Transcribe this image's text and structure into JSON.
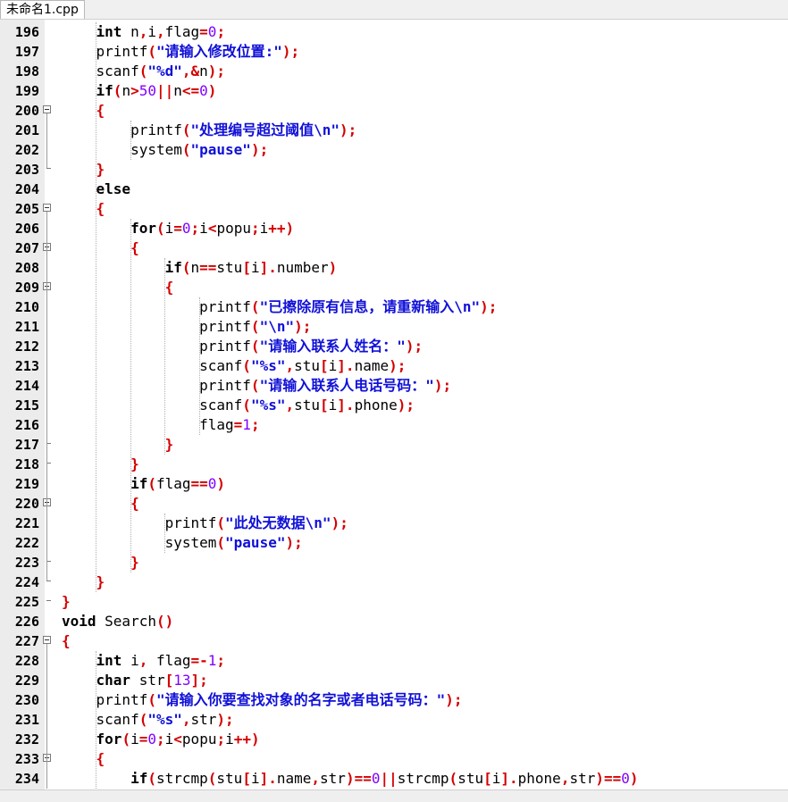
{
  "tab": {
    "title": "未命名1.cpp"
  },
  "status": {
    "items": [
      "",
      "",
      "",
      "",
      ""
    ]
  },
  "lines": [
    {
      "n": "196",
      "fold": "",
      "segs": [
        [
          "",
          "    "
        ],
        [
          "kw",
          "int"
        ],
        [
          "",
          " n"
        ],
        [
          "sym",
          ","
        ],
        [
          "",
          "i"
        ],
        [
          "sym",
          ","
        ],
        [
          "",
          "flag"
        ],
        [
          "sym",
          "="
        ],
        [
          "num",
          "0"
        ],
        [
          "sym",
          ";"
        ]
      ]
    },
    {
      "n": "197",
      "fold": "",
      "segs": [
        [
          "",
          "    printf"
        ],
        [
          "sym",
          "("
        ],
        [
          "str",
          "\"请输入修改位置:\""
        ],
        [
          "sym",
          ");"
        ]
      ]
    },
    {
      "n": "198",
      "fold": "",
      "segs": [
        [
          "",
          "    scanf"
        ],
        [
          "sym",
          "("
        ],
        [
          "str",
          "\"%d\""
        ],
        [
          "sym",
          ",&"
        ],
        [
          "",
          "n"
        ],
        [
          "sym",
          ");"
        ]
      ]
    },
    {
      "n": "199",
      "fold": "",
      "segs": [
        [
          "",
          "    "
        ],
        [
          "kw",
          "if"
        ],
        [
          "sym",
          "("
        ],
        [
          "",
          "n"
        ],
        [
          "sym",
          ">"
        ],
        [
          "num",
          "50"
        ],
        [
          "sym",
          "||"
        ],
        [
          "",
          "n"
        ],
        [
          "sym",
          "<="
        ],
        [
          "num",
          "0"
        ],
        [
          "sym",
          ")"
        ]
      ]
    },
    {
      "n": "200",
      "fold": "open",
      "segs": [
        [
          "",
          "    "
        ],
        [
          "sym",
          "{"
        ]
      ]
    },
    {
      "n": "201",
      "fold": "",
      "segs": [
        [
          "",
          "        printf"
        ],
        [
          "sym",
          "("
        ],
        [
          "str",
          "\"处理编号超过阈值\\n\""
        ],
        [
          "sym",
          ");"
        ]
      ]
    },
    {
      "n": "202",
      "fold": "",
      "segs": [
        [
          "",
          "        system"
        ],
        [
          "sym",
          "("
        ],
        [
          "str",
          "\"pause\""
        ],
        [
          "sym",
          ");"
        ]
      ]
    },
    {
      "n": "203",
      "fold": "end",
      "segs": [
        [
          "",
          "    "
        ],
        [
          "sym",
          "}"
        ]
      ]
    },
    {
      "n": "204",
      "fold": "",
      "segs": [
        [
          "",
          "    "
        ],
        [
          "kw",
          "else"
        ]
      ]
    },
    {
      "n": "205",
      "fold": "open",
      "segs": [
        [
          "",
          "    "
        ],
        [
          "sym",
          "{"
        ]
      ]
    },
    {
      "n": "206",
      "fold": "",
      "segs": [
        [
          "",
          "        "
        ],
        [
          "kw",
          "for"
        ],
        [
          "sym",
          "("
        ],
        [
          "",
          "i"
        ],
        [
          "sym",
          "="
        ],
        [
          "num",
          "0"
        ],
        [
          "sym",
          ";"
        ],
        [
          "",
          "i"
        ],
        [
          "sym",
          "<"
        ],
        [
          "",
          "popu"
        ],
        [
          "sym",
          ";"
        ],
        [
          "",
          "i"
        ],
        [
          "sym",
          "++)"
        ]
      ]
    },
    {
      "n": "207",
      "fold": "open",
      "segs": [
        [
          "",
          "        "
        ],
        [
          "sym",
          "{"
        ]
      ]
    },
    {
      "n": "208",
      "fold": "",
      "segs": [
        [
          "",
          "            "
        ],
        [
          "kw",
          "if"
        ],
        [
          "sym",
          "("
        ],
        [
          "",
          "n"
        ],
        [
          "sym",
          "=="
        ],
        [
          "",
          "stu"
        ],
        [
          "sym",
          "["
        ],
        [
          "",
          "i"
        ],
        [
          "sym",
          "]."
        ],
        [
          "",
          "number"
        ],
        [
          "sym",
          ")"
        ]
      ]
    },
    {
      "n": "209",
      "fold": "open",
      "segs": [
        [
          "",
          "            "
        ],
        [
          "sym",
          "{"
        ]
      ]
    },
    {
      "n": "210",
      "fold": "",
      "segs": [
        [
          "",
          "                printf"
        ],
        [
          "sym",
          "("
        ],
        [
          "str",
          "\"已擦除原有信息，请重新输入\\n\""
        ],
        [
          "sym",
          ");"
        ]
      ]
    },
    {
      "n": "211",
      "fold": "",
      "segs": [
        [
          "",
          "                printf"
        ],
        [
          "sym",
          "("
        ],
        [
          "str",
          "\"\\n\""
        ],
        [
          "sym",
          ");"
        ]
      ]
    },
    {
      "n": "212",
      "fold": "",
      "segs": [
        [
          "",
          "                printf"
        ],
        [
          "sym",
          "("
        ],
        [
          "str",
          "\"请输入联系人姓名：\""
        ],
        [
          "sym",
          ");"
        ]
      ]
    },
    {
      "n": "213",
      "fold": "",
      "segs": [
        [
          "",
          "                scanf"
        ],
        [
          "sym",
          "("
        ],
        [
          "str",
          "\"%s\""
        ],
        [
          "sym",
          ","
        ],
        [
          "",
          "stu"
        ],
        [
          "sym",
          "["
        ],
        [
          "",
          "i"
        ],
        [
          "sym",
          "]."
        ],
        [
          "",
          "name"
        ],
        [
          "sym",
          ");"
        ]
      ]
    },
    {
      "n": "214",
      "fold": "",
      "segs": [
        [
          "",
          "                printf"
        ],
        [
          "sym",
          "("
        ],
        [
          "str",
          "\"请输入联系人电话号码：\""
        ],
        [
          "sym",
          ");"
        ]
      ]
    },
    {
      "n": "215",
      "fold": "",
      "segs": [
        [
          "",
          "                scanf"
        ],
        [
          "sym",
          "("
        ],
        [
          "str",
          "\"%s\""
        ],
        [
          "sym",
          ","
        ],
        [
          "",
          "stu"
        ],
        [
          "sym",
          "["
        ],
        [
          "",
          "i"
        ],
        [
          "sym",
          "]."
        ],
        [
          "",
          "phone"
        ],
        [
          "sym",
          ");"
        ]
      ]
    },
    {
      "n": "216",
      "fold": "",
      "segs": [
        [
          "",
          "                flag"
        ],
        [
          "sym",
          "="
        ],
        [
          "num",
          "1"
        ],
        [
          "sym",
          ";"
        ]
      ]
    },
    {
      "n": "217",
      "fold": "end",
      "segs": [
        [
          "",
          "            "
        ],
        [
          "sym",
          "}"
        ]
      ]
    },
    {
      "n": "218",
      "fold": "end",
      "segs": [
        [
          "",
          "        "
        ],
        [
          "sym",
          "}"
        ]
      ]
    },
    {
      "n": "219",
      "fold": "",
      "segs": [
        [
          "",
          "        "
        ],
        [
          "kw",
          "if"
        ],
        [
          "sym",
          "("
        ],
        [
          "",
          "flag"
        ],
        [
          "sym",
          "=="
        ],
        [
          "num",
          "0"
        ],
        [
          "sym",
          ")"
        ]
      ]
    },
    {
      "n": "220",
      "fold": "open",
      "segs": [
        [
          "",
          "        "
        ],
        [
          "sym",
          "{"
        ]
      ]
    },
    {
      "n": "221",
      "fold": "",
      "segs": [
        [
          "",
          "            printf"
        ],
        [
          "sym",
          "("
        ],
        [
          "str",
          "\"此处无数据\\n\""
        ],
        [
          "sym",
          ");"
        ]
      ]
    },
    {
      "n": "222",
      "fold": "",
      "segs": [
        [
          "",
          "            system"
        ],
        [
          "sym",
          "("
        ],
        [
          "str",
          "\"pause\""
        ],
        [
          "sym",
          ");"
        ]
      ]
    },
    {
      "n": "223",
      "fold": "end",
      "segs": [
        [
          "",
          "        "
        ],
        [
          "sym",
          "}"
        ]
      ]
    },
    {
      "n": "224",
      "fold": "end",
      "segs": [
        [
          "",
          "    "
        ],
        [
          "sym",
          "}"
        ]
      ]
    },
    {
      "n": "225",
      "fold": "end",
      "segs": [
        [
          "sym",
          "}"
        ]
      ]
    },
    {
      "n": "226",
      "fold": "",
      "segs": [
        [
          "kw",
          "void"
        ],
        [
          "",
          " Search"
        ],
        [
          "sym",
          "()"
        ]
      ]
    },
    {
      "n": "227",
      "fold": "open",
      "segs": [
        [
          "sym",
          "{"
        ]
      ]
    },
    {
      "n": "228",
      "fold": "",
      "segs": [
        [
          "",
          "    "
        ],
        [
          "kw",
          "int"
        ],
        [
          "",
          " i"
        ],
        [
          "sym",
          ","
        ],
        [
          "",
          " flag"
        ],
        [
          "sym",
          "=-"
        ],
        [
          "num",
          "1"
        ],
        [
          "sym",
          ";"
        ]
      ]
    },
    {
      "n": "229",
      "fold": "",
      "segs": [
        [
          "",
          "    "
        ],
        [
          "kw",
          "char"
        ],
        [
          "",
          " str"
        ],
        [
          "sym",
          "["
        ],
        [
          "num",
          "13"
        ],
        [
          "sym",
          "];"
        ]
      ]
    },
    {
      "n": "230",
      "fold": "",
      "segs": [
        [
          "",
          "    printf"
        ],
        [
          "sym",
          "("
        ],
        [
          "str",
          "\"请输入你要查找对象的名字或者电话号码：\""
        ],
        [
          "sym",
          ");"
        ]
      ]
    },
    {
      "n": "231",
      "fold": "",
      "segs": [
        [
          "",
          "    scanf"
        ],
        [
          "sym",
          "("
        ],
        [
          "str",
          "\"%s\""
        ],
        [
          "sym",
          ","
        ],
        [
          "",
          "str"
        ],
        [
          "sym",
          ");"
        ]
      ]
    },
    {
      "n": "232",
      "fold": "",
      "segs": [
        [
          "",
          "    "
        ],
        [
          "kw",
          "for"
        ],
        [
          "sym",
          "("
        ],
        [
          "",
          "i"
        ],
        [
          "sym",
          "="
        ],
        [
          "num",
          "0"
        ],
        [
          "sym",
          ";"
        ],
        [
          "",
          "i"
        ],
        [
          "sym",
          "<"
        ],
        [
          "",
          "popu"
        ],
        [
          "sym",
          ";"
        ],
        [
          "",
          "i"
        ],
        [
          "sym",
          "++)"
        ]
      ]
    },
    {
      "n": "233",
      "fold": "open",
      "segs": [
        [
          "",
          "    "
        ],
        [
          "sym",
          "{"
        ]
      ]
    },
    {
      "n": "234",
      "fold": "",
      "segs": [
        [
          "",
          "        "
        ],
        [
          "kw",
          "if"
        ],
        [
          "sym",
          "("
        ],
        [
          "",
          "strcmp"
        ],
        [
          "sym",
          "("
        ],
        [
          "",
          "stu"
        ],
        [
          "sym",
          "["
        ],
        [
          "",
          "i"
        ],
        [
          "sym",
          "]."
        ],
        [
          "",
          "name"
        ],
        [
          "sym",
          ","
        ],
        [
          "",
          "str"
        ],
        [
          "sym",
          ")=="
        ],
        [
          "num",
          "0"
        ],
        [
          "sym",
          "||"
        ],
        [
          "",
          "strcmp"
        ],
        [
          "sym",
          "("
        ],
        [
          "",
          "stu"
        ],
        [
          "sym",
          "["
        ],
        [
          "",
          "i"
        ],
        [
          "sym",
          "]."
        ],
        [
          "",
          "phone"
        ],
        [
          "sym",
          ","
        ],
        [
          "",
          "str"
        ],
        [
          "sym",
          ")=="
        ],
        [
          "num",
          "0"
        ],
        [
          "sym",
          ")"
        ]
      ]
    }
  ]
}
